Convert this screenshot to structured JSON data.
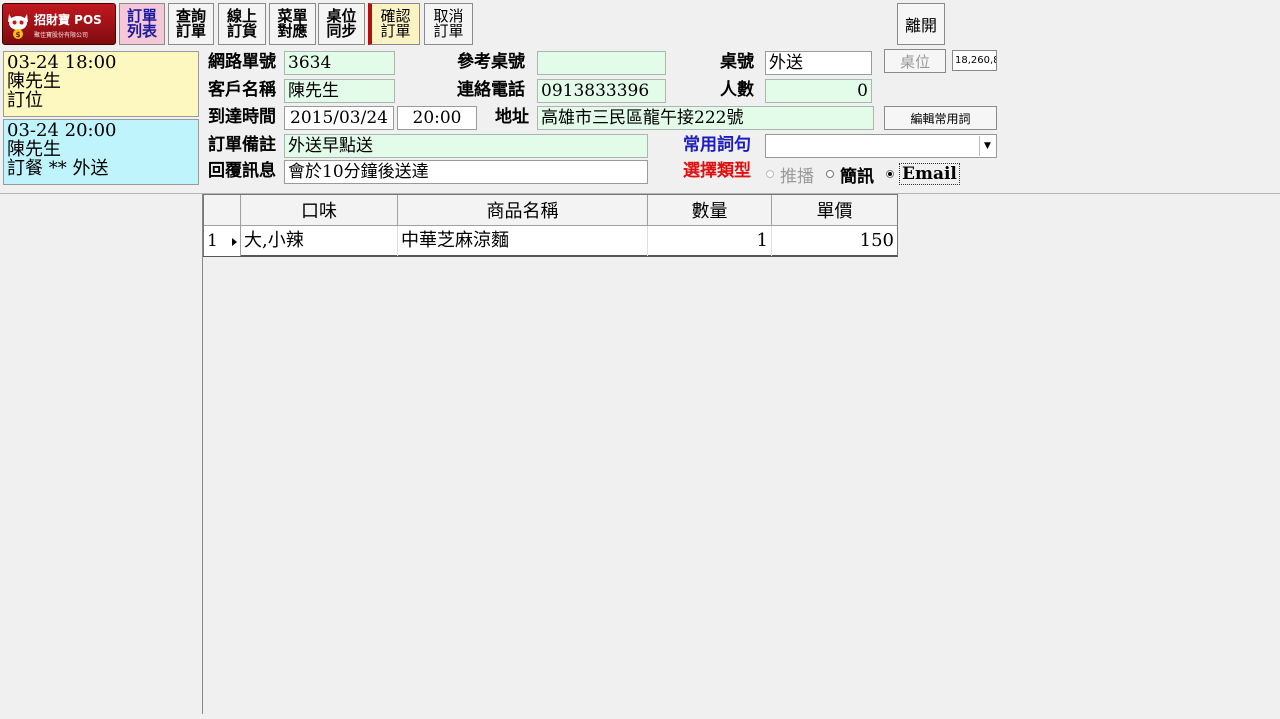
{
  "toolbar": {
    "logo_title": "招財寶 POS",
    "logo_subtitle": "聚佳寶股份有限公司",
    "buttons": [
      {
        "label": "訂單列表"
      },
      {
        "label": "查詢訂單"
      },
      {
        "label": "線上訂貨"
      },
      {
        "label": "菜單對應"
      },
      {
        "label": "桌位同步"
      },
      {
        "label": "確認訂單"
      },
      {
        "label": "取消訂單"
      }
    ],
    "exit_label": "離開"
  },
  "orders": [
    {
      "time": "03-24 18:00",
      "name": "陳先生",
      "type": "訂位"
    },
    {
      "time": "03-24 20:00",
      "name": "陳先生",
      "type": "訂餐 ** 外送"
    }
  ],
  "form": {
    "order_no_label": "網路單號",
    "order_no": "3634",
    "ref_table_label": "參考桌號",
    "ref_table": "",
    "table_label": "桌號",
    "table": "外送",
    "seat_button": "桌位",
    "seat_value": "18,260,8",
    "customer_label": "客戶名稱",
    "customer": "陳先生",
    "phone_label": "連絡電話",
    "phone": "0913833396",
    "people_label": "人數",
    "people": "0",
    "arrive_label": "到達時間",
    "arrive_date": "2015/03/24",
    "arrive_time": "20:00",
    "address_label": "地址",
    "address": "高雄市三民區龍午接222號",
    "edit_phrases_button": "編輯常用詞",
    "note_label": "訂單備註",
    "note": "外送早點送",
    "phrase_label": "常用詞句",
    "phrase_value": "",
    "reply_label": "回覆訊息",
    "reply": "會於10分鐘後送達",
    "type_label": "選擇類型",
    "types": [
      {
        "label": "推播",
        "state": "disabled"
      },
      {
        "label": "簡訊",
        "state": "enabled"
      },
      {
        "label": "Email",
        "state": "selected"
      }
    ]
  },
  "grid": {
    "columns": [
      "口味",
      "商品名稱",
      "數量",
      "單價"
    ],
    "rows": [
      {
        "no": "1",
        "flavor": "大,小辣",
        "name": "中華芝麻涼麵",
        "qty": "1",
        "price": "150"
      }
    ]
  }
}
